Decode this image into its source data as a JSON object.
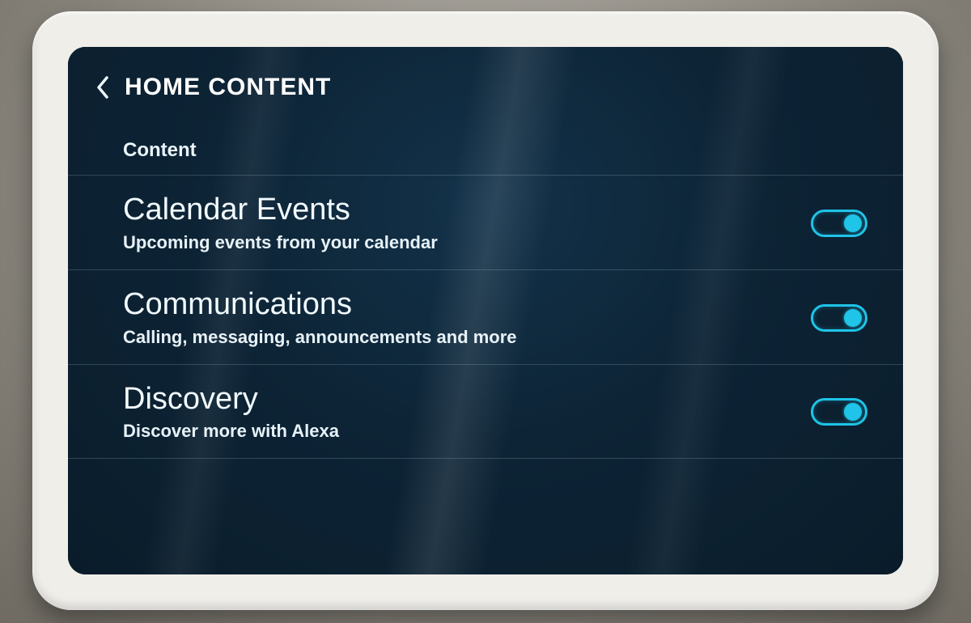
{
  "header": {
    "title": "HOME CONTENT",
    "back_icon": "chevron-left"
  },
  "section": {
    "label": "Content"
  },
  "items": [
    {
      "title": "Calendar Events",
      "subtitle": "Upcoming events from your calendar",
      "toggle": true
    },
    {
      "title": "Communications",
      "subtitle": "Calling, messaging, announcements and more",
      "toggle": true
    },
    {
      "title": "Discovery",
      "subtitle": "Discover more with Alexa",
      "toggle": true
    }
  ],
  "colors": {
    "accent": "#1fc4e8",
    "background": "#0d2436",
    "text": "#e9f3f8"
  }
}
